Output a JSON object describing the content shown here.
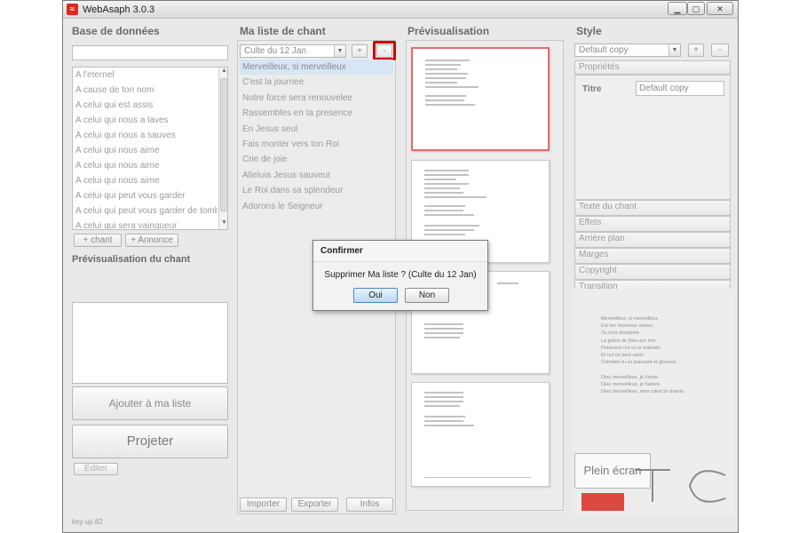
{
  "window": {
    "title": "WebAsaph 3.0.3",
    "controls": [
      "minimize-icon",
      "maximize-icon",
      "close-icon"
    ]
  },
  "database": {
    "title": "Base de données",
    "search_value": "",
    "songs": [
      "A l'eternel",
      "A cause de ton nom",
      "A celui qui est assis",
      "A celui qui nous a laves",
      "A celui qui nous a sauves",
      "A celui qui nous aime",
      "A celui qui nous aime",
      "A celui qui nous aime",
      "A celui qui peut vous garder",
      "A celui qui peut vous garder de tomber",
      "A celui qui sera vainqueur"
    ],
    "add_song_label": "+ chant",
    "add_announce_label": "+ Annonce",
    "preview_title": "Prévisualisation du chant",
    "add_to_list_label": "Ajouter à ma liste",
    "project_label": "Projeter",
    "edit_label": "Editer",
    "status_text": "key up 82"
  },
  "my_list": {
    "title": "Ma liste de chant",
    "selected_list": "Culte du 12 Jan",
    "add_label": "+",
    "remove_label": "-",
    "songs": [
      "Merveilleux, si merveilleux",
      "C'est la journee",
      "Notre force sera renouvelee",
      "Rassembles en ta presence",
      "En Jesus seul",
      "Fais monter vers ton Roi",
      "Crie de joie",
      "Alleluia Jesus sauveur",
      "Le Roi dans sa splendeur",
      "Adorons le Seigneur"
    ],
    "selected_index": 0,
    "import_label": "Importer",
    "export_label": "Exporter",
    "info_label": "Infos"
  },
  "preview": {
    "title": "Prévisualisation"
  },
  "style": {
    "title": "Style",
    "selected_style": "Default copy",
    "add_label": "+",
    "remove_label": "-",
    "properties_tab": "Propriétés",
    "field_label": "Titre",
    "field_value": "Default copy",
    "sections": [
      "Texte du chant",
      "Effets",
      "Arrière plan",
      "Marges",
      "Copyright",
      "Transition"
    ],
    "fullscreen_label": "Plein écran",
    "preview_lines": [
      "Merveilleux, si merveilleux",
      "Est ton immense amour.",
      "Ta croix proclame",
      "La grâce de Dieu sur moi.",
      "Personne n'a vu ni entendu",
      "Et nul ne peut saisir",
      "Combien tu es puissant et glorieux.",
      "",
      "Dieu merveilleux, je t'aime.",
      "Dieu merveilleux, je t'adore.",
      "Dieu merveilleux, mon cœur te chante."
    ]
  },
  "dialog": {
    "title": "Confirmer",
    "message": "Supprimer Ma liste ? (Culte du 12 Jan)",
    "yes_label": "Oui",
    "no_label": "Non"
  },
  "colors": {
    "highlight_box": "#cc0000",
    "selected_row": "#d7e5f5",
    "selected_slide_border": "#e36b6b",
    "logo_red": "#d92c1f"
  }
}
